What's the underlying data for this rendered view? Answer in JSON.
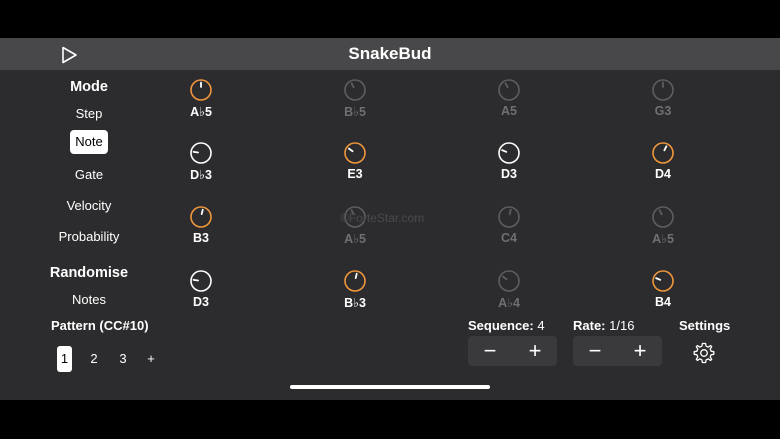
{
  "app": {
    "title": "SnakeBud"
  },
  "sidebar": {
    "mode_heading": "Mode",
    "modes": [
      "Step",
      "Note",
      "Gate",
      "Velocity",
      "Probability"
    ],
    "selected_mode": "Note",
    "randomise_heading": "Randomise",
    "randomise_item": "Notes",
    "pattern_label": "Pattern (CC#10)",
    "patterns": [
      "1",
      "2",
      "3"
    ],
    "selected_pattern": "1",
    "add_pattern": "+"
  },
  "grid": {
    "rows": [
      [
        {
          "note": "A♭5",
          "level": 0.5,
          "active": true,
          "orange": true
        },
        {
          "note": "B♭5",
          "level": 0.4,
          "active": false,
          "orange": false
        },
        {
          "note": "A5",
          "level": 0.4,
          "active": false,
          "orange": false
        },
        {
          "note": "G3",
          "level": 0.5,
          "active": false,
          "orange": false
        }
      ],
      [
        {
          "note": "D♭3",
          "level": 0.2,
          "active": true,
          "orange": false
        },
        {
          "note": "E3",
          "level": 0.3,
          "active": true,
          "orange": true
        },
        {
          "note": "D3",
          "level": 0.25,
          "active": true,
          "orange": false
        },
        {
          "note": "D4",
          "level": 0.6,
          "active": true,
          "orange": true
        }
      ],
      [
        {
          "note": "B3",
          "level": 0.55,
          "active": true,
          "orange": true
        },
        {
          "note": "A♭5",
          "level": 0.4,
          "active": false,
          "orange": false
        },
        {
          "note": "C4",
          "level": 0.55,
          "active": false,
          "orange": false
        },
        {
          "note": "A♭5",
          "level": 0.4,
          "active": false,
          "orange": false
        }
      ],
      [
        {
          "note": "D3",
          "level": 0.2,
          "active": true,
          "orange": false
        },
        {
          "note": "B♭3",
          "level": 0.55,
          "active": true,
          "orange": true
        },
        {
          "note": "A♭4",
          "level": 0.3,
          "active": false,
          "orange": false
        },
        {
          "note": "B4",
          "level": 0.25,
          "active": true,
          "orange": true
        }
      ]
    ]
  },
  "controls": {
    "sequence_label": "Sequence:",
    "sequence_value": "4",
    "rate_label": "Rate:",
    "rate_value": "1/16",
    "settings_label": "Settings",
    "minus": "−",
    "plus": "+"
  },
  "watermark": "©ForteStar.com",
  "colors": {
    "accent": "#f0963c",
    "knob_active": "#ffffff",
    "knob_dim": "#5e5e62"
  },
  "icons": {
    "play": "play-icon",
    "settings": "gear-icon"
  }
}
